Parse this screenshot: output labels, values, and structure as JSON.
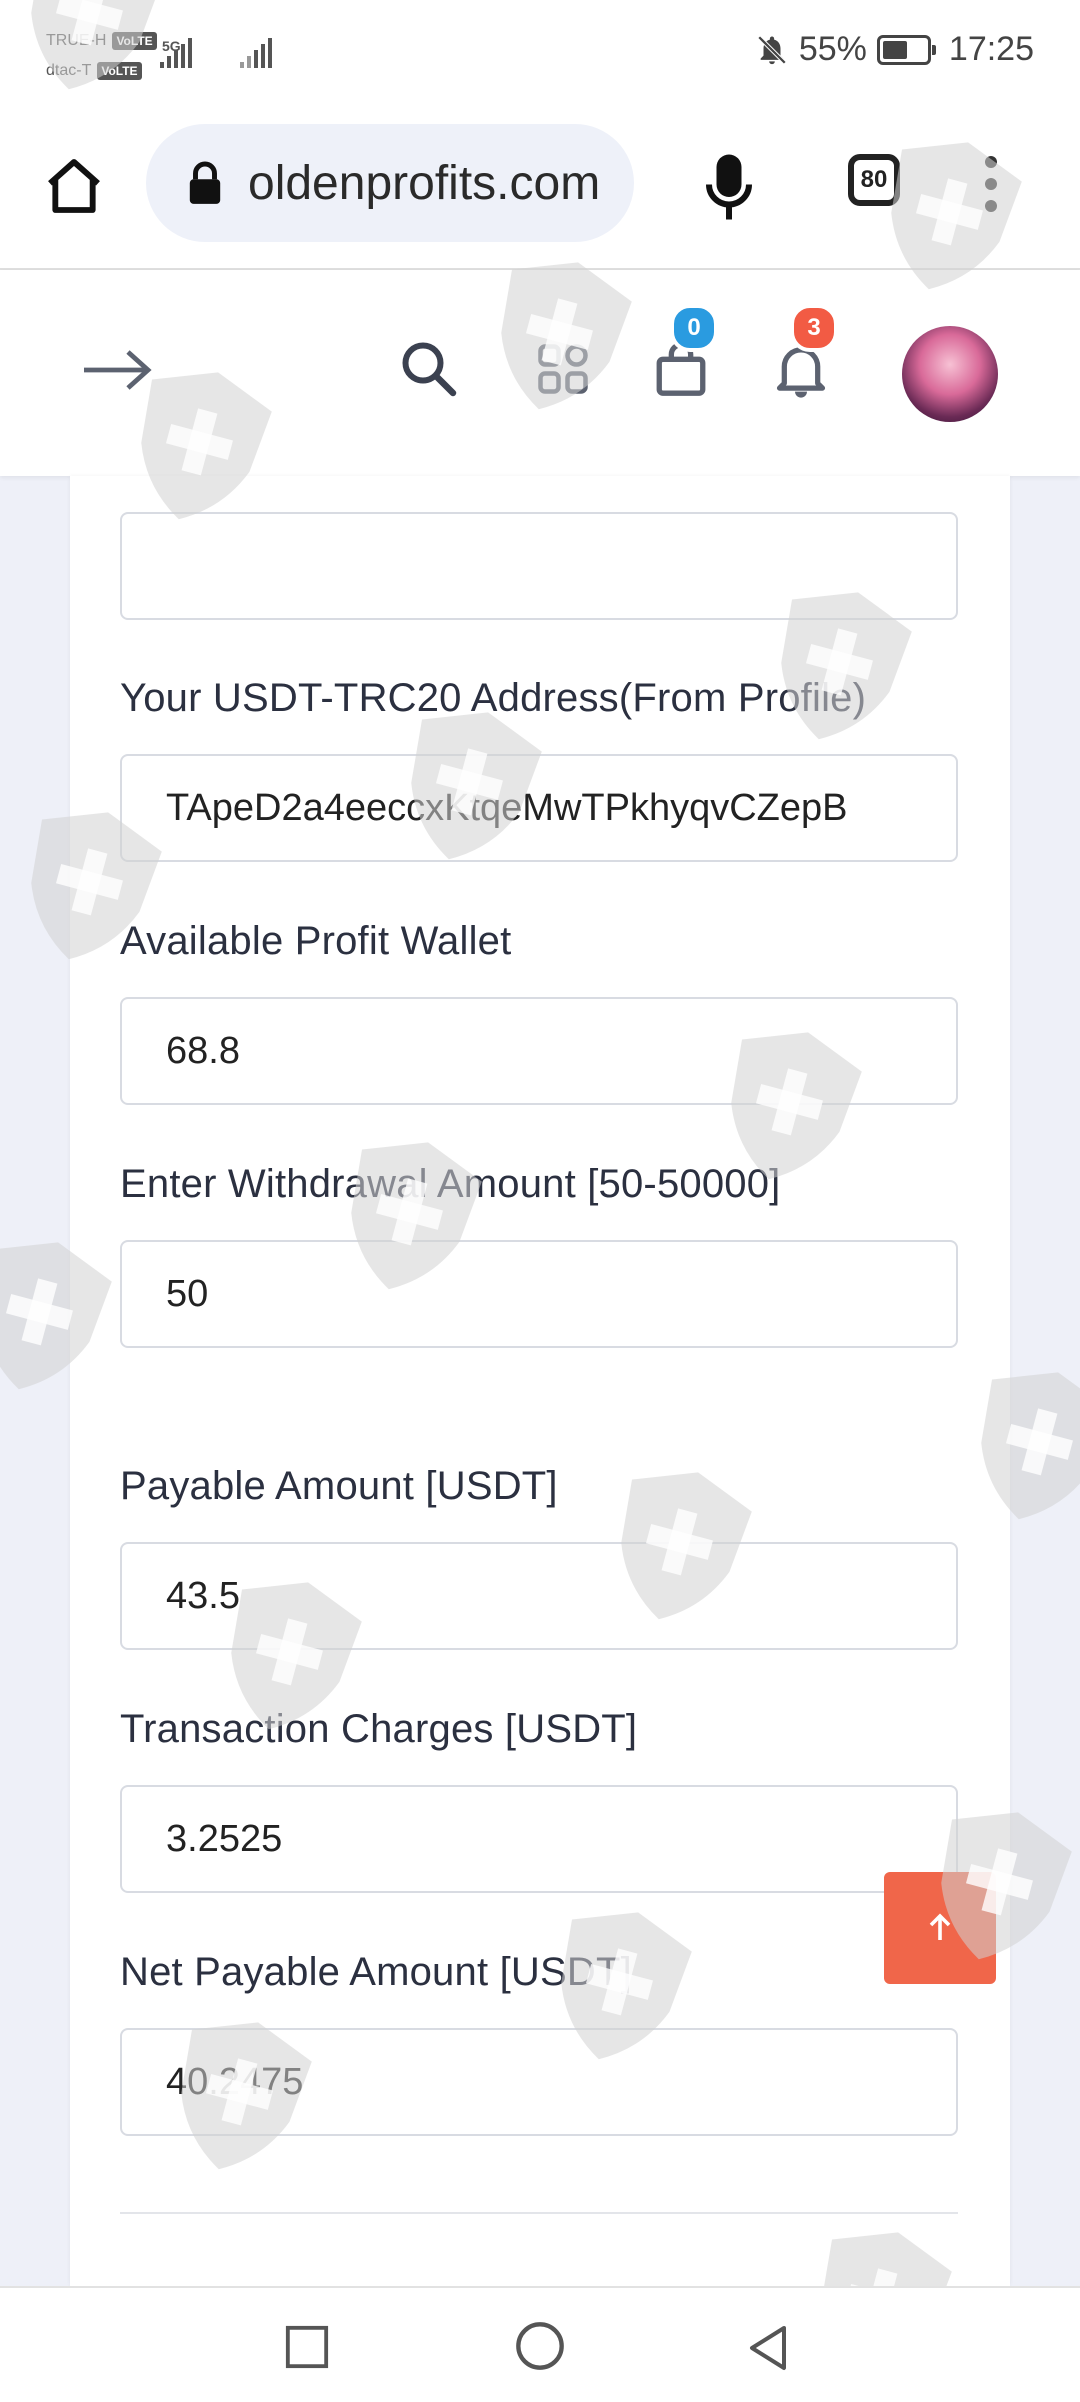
{
  "status_bar": {
    "carrier1": "TRUE-H",
    "carrier2": "dtac-T",
    "volte_label": "VoLTE",
    "network": "5G",
    "battery": "55%",
    "time": "17:25"
  },
  "browser": {
    "url": "oldenprofits.com",
    "tab_count": "80"
  },
  "header": {
    "cart_badge": "0",
    "notifications_badge": "3"
  },
  "form": {
    "fields": [
      {
        "label": "",
        "value": ""
      },
      {
        "label": "Your USDT-TRC20 Address(From Profile)",
        "value": "TApeD2a4eeccxKtqeMwTPkhyqvCZepB"
      },
      {
        "label": "Available Profit Wallet",
        "value": "68.8"
      },
      {
        "label": "Enter Withdrawal Amount [50-50000]",
        "value": "50"
      },
      {
        "label": "Payable Amount [USDT]",
        "value": "43.5"
      },
      {
        "label": "Transaction Charges [USDT]",
        "value": "3.2525"
      },
      {
        "label": "Net Payable Amount [USDT]",
        "value": "40.2475"
      }
    ]
  },
  "colors": {
    "accent": "#f0664a",
    "badge_blue": "#2a9be0",
    "badge_red": "#f25b44",
    "background": "#eef0f8"
  },
  "icons": [
    "home-icon",
    "lock-icon",
    "mic-icon",
    "tabs-icon",
    "menu-icon",
    "arrow-right-icon",
    "search-icon",
    "apps-icon",
    "cart-icon",
    "bell-icon",
    "arrow-up-icon",
    "square-icon",
    "circle-icon",
    "back-icon"
  ]
}
